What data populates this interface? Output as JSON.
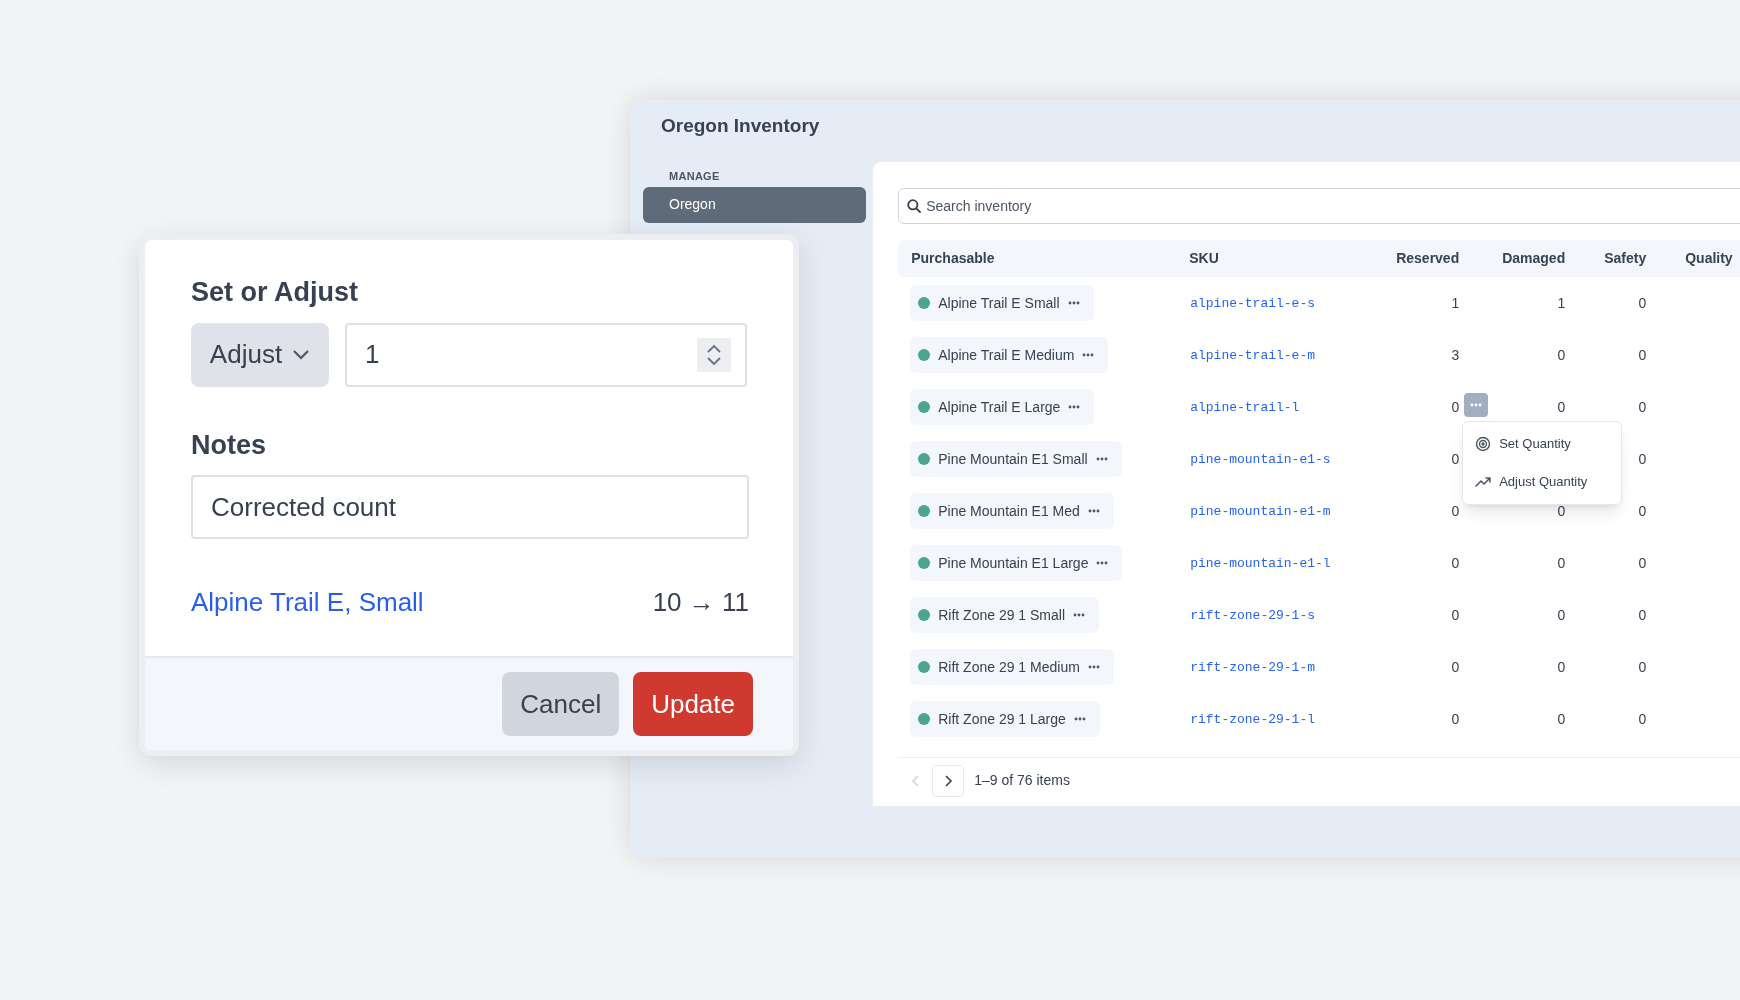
{
  "window": {
    "title": "Oregon Inventory"
  },
  "sidebar": {
    "section": "MANAGE",
    "items": [
      {
        "label": "Oregon",
        "selected": true
      }
    ]
  },
  "search": {
    "placeholder": "Search inventory"
  },
  "table": {
    "columns": [
      "Purchasable",
      "SKU",
      "Reserved",
      "Damaged",
      "Safety",
      "Quality"
    ],
    "rows": [
      {
        "purchasable": "Alpine Trail E Small",
        "sku": "alpine-trail-e-s",
        "reserved": "1",
        "damaged": "1",
        "safety": "0",
        "menu_open": false
      },
      {
        "purchasable": "Alpine Trail E Medium",
        "sku": "alpine-trail-e-m",
        "reserved": "3",
        "damaged": "0",
        "safety": "0",
        "menu_open": false
      },
      {
        "purchasable": "Alpine Trail E Large",
        "sku": "alpine-trail-l",
        "reserved": "0",
        "damaged": "0",
        "safety": "0",
        "menu_open": true
      },
      {
        "purchasable": "Pine Mountain E1 Small",
        "sku": "pine-mountain-e1-s",
        "reserved": "0",
        "safety": "0",
        "menu_open": false
      },
      {
        "purchasable": "Pine Mountain E1 Med",
        "sku": "pine-mountain-e1-m",
        "reserved": "0",
        "damaged": "0",
        "safety": "0",
        "menu_open": false
      },
      {
        "purchasable": "Pine Mountain E1 Large",
        "sku": "pine-mountain-e1-l",
        "reserved": "0",
        "damaged": "0",
        "safety": "0",
        "menu_open": false
      },
      {
        "purchasable": "Rift Zone 29 1 Small",
        "sku": "rift-zone-29-1-s",
        "reserved": "0",
        "damaged": "0",
        "safety": "0",
        "menu_open": false
      },
      {
        "purchasable": "Rift Zone 29 1 Medium",
        "sku": "rift-zone-29-1-m",
        "reserved": "0",
        "damaged": "0",
        "safety": "0",
        "menu_open": false
      },
      {
        "purchasable": "Rift Zone 29 1 Large",
        "sku": "rift-zone-29-1-l",
        "reserved": "0",
        "damaged": "0",
        "safety": "0",
        "menu_open": false
      }
    ]
  },
  "row_menu": {
    "items": [
      {
        "kind": "target",
        "label": "Set Quantity"
      },
      {
        "kind": "trend",
        "label": "Adjust Quantity"
      }
    ]
  },
  "pagination": {
    "prev_disabled": true,
    "summary": "1–9 of 76 items"
  },
  "dialog": {
    "title": "Set or Adjust",
    "mode": "Adjust",
    "amount": "1",
    "notes_label": "Notes",
    "notes": "Corrected count",
    "item_link": "Alpine Trail E, Small",
    "change": "10 → 11",
    "buttons": [
      "Cancel",
      "Update"
    ]
  }
}
